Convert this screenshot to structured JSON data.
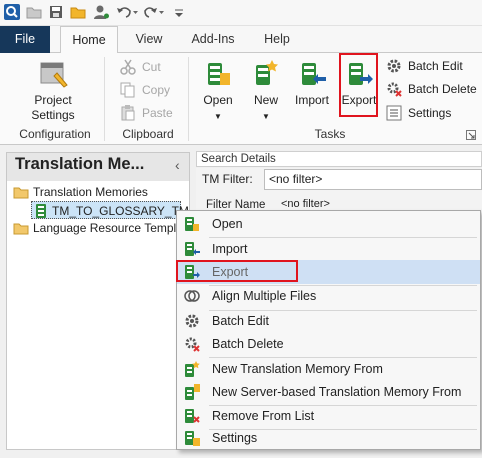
{
  "colors": {
    "accent": "#16375a",
    "highlight_box": "#e0141e",
    "menu_hover": "#cfe0f4",
    "tm_green": "#2e8b3a",
    "tm_yellow": "#f2b52b"
  },
  "quick_access": {
    "icons": [
      "app-icon",
      "open-folder-icon",
      "save-icon",
      "folder-open-icon",
      "user-settings-icon",
      "undo-icon",
      "redo-icon",
      "customize-icon"
    ]
  },
  "ribbon_tabs": [
    "File",
    "Home",
    "View",
    "Add-Ins",
    "Help"
  ],
  "ribbon": {
    "configuration": {
      "label": "Configuration",
      "project_settings": "Project\nSettings"
    },
    "clipboard": {
      "label": "Clipboard",
      "cut": "Cut",
      "copy": "Copy",
      "paste": "Paste"
    },
    "tasks": {
      "label": "Tasks",
      "open": "Open",
      "new": "New",
      "import": "Import",
      "export": "Export",
      "batch_edit": "Batch Edit",
      "batch_delete": "Batch Delete",
      "settings": "Settings"
    }
  },
  "nav": {
    "title": "Translation  Me...",
    "collapse": "‹",
    "tree": [
      {
        "label": "Translation Memories"
      },
      {
        "label": "TM_TO_GLOSSARY_TM"
      },
      {
        "label": "Language Resource Templates"
      }
    ]
  },
  "right_pane": {
    "search_details": "Search Details",
    "tm_filter_label": "TM Filter:",
    "tm_filter_value": "<no filter>",
    "filter_name_label": "Filter Name",
    "filter_name_value": "<no filter>",
    "partial_text": "~~~ ~~~~~~~"
  },
  "context_menu": {
    "items": [
      {
        "label": "Open",
        "icon": "open-tm-icon"
      },
      {
        "label": "Import",
        "icon": "import-tm-icon"
      },
      {
        "label": "Export",
        "icon": "export-tm-icon",
        "highlighted": true
      },
      {
        "label": "Align Multiple Files",
        "icon": "align-files-icon"
      },
      {
        "label": "Batch Edit",
        "icon": "gear-icon"
      },
      {
        "label": "Batch Delete",
        "icon": "batch-delete-icon"
      },
      {
        "label": "New Translation Memory From",
        "icon": "new-tm-from-icon"
      },
      {
        "label": "New Server-based Translation Memory From",
        "icon": "new-server-tm-icon"
      },
      {
        "label": "Remove From List",
        "icon": "remove-from-list-icon"
      },
      {
        "label": "Settings",
        "icon": "settings-icon"
      }
    ]
  }
}
